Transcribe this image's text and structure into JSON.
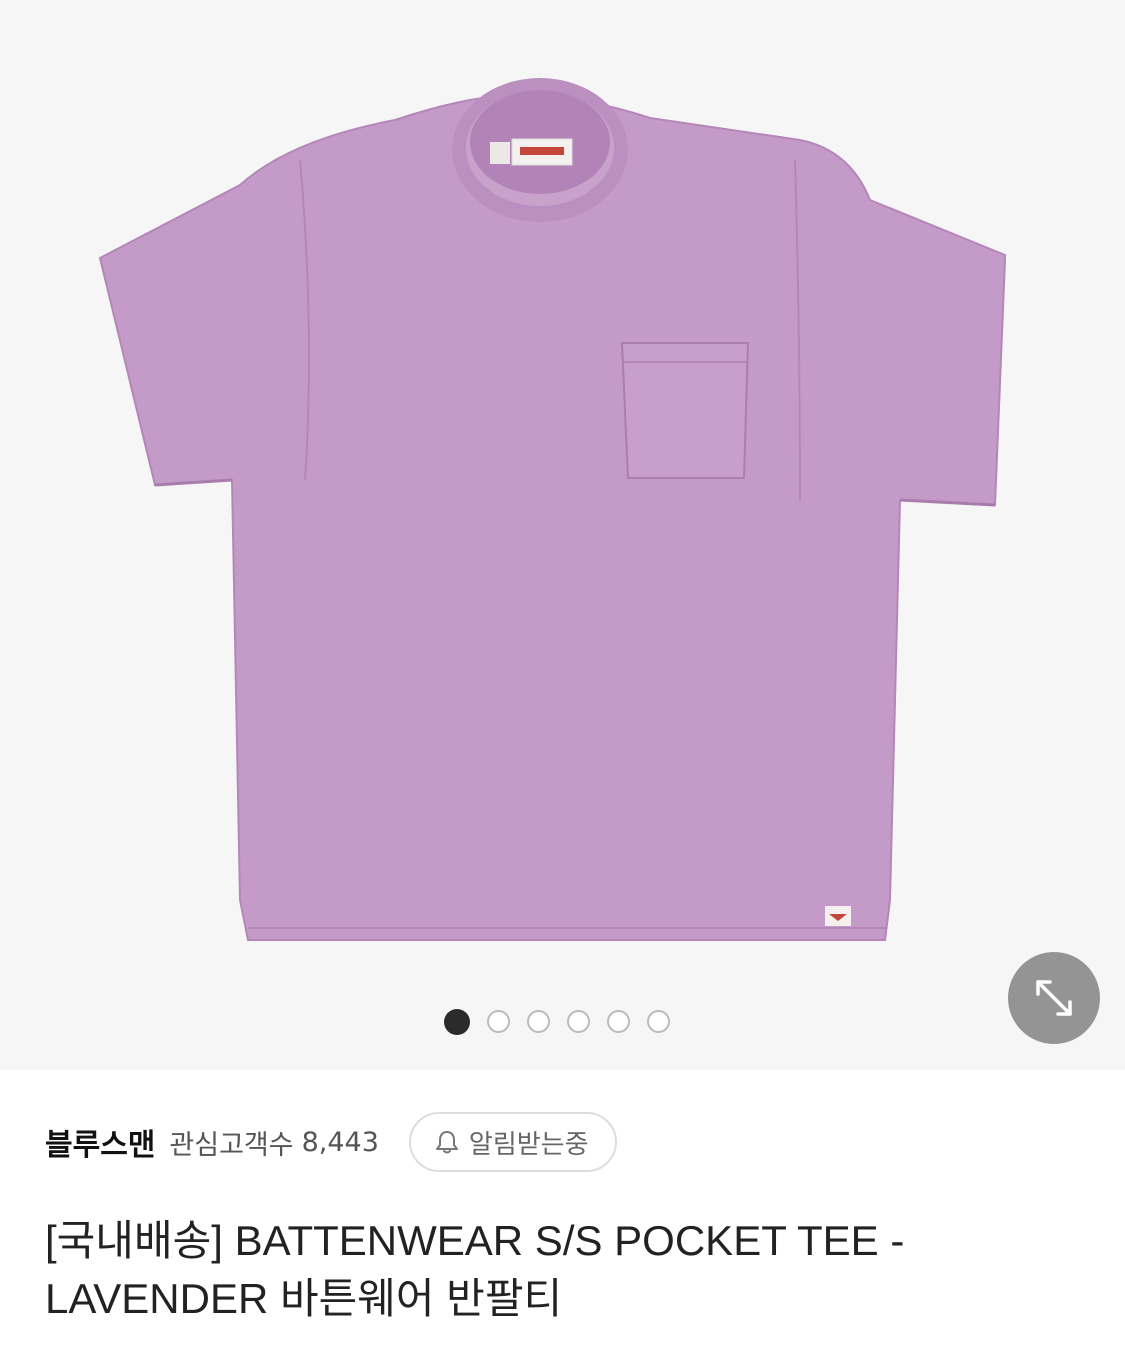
{
  "gallery": {
    "image_alt": "lavender short sleeve pocket t-shirt",
    "total_images": 6,
    "active_index": 0,
    "expand_icon": "expand-diagonal-icon"
  },
  "seller": {
    "name": "블루스맨",
    "follower_label": "관심고객수",
    "follower_count": "8,443",
    "notify_icon": "bell-icon",
    "notify_label": "알림받는중"
  },
  "product": {
    "title_line1": "[국내배송] BATTENWEAR S/S POCKET TEE -",
    "title_line2": "LAVENDER 바튼웨어 반팔티"
  },
  "colors": {
    "shirt": "#c49ac8",
    "expand_button": "#8a8a8a",
    "active_dot": "#2b2b2b"
  }
}
